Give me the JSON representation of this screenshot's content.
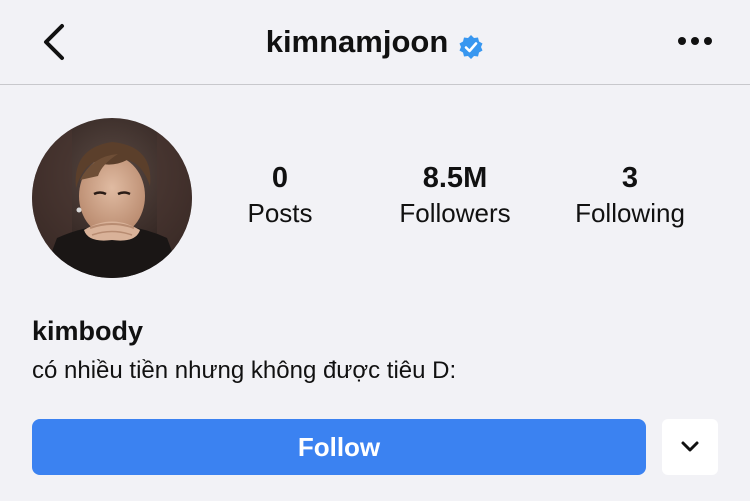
{
  "header": {
    "username": "kimnamjoon",
    "verified": true,
    "back_icon": "chevron-left-icon",
    "more_icon": "ellipsis-icon"
  },
  "profile": {
    "avatar": "profile-photo",
    "display_name": "kimbody",
    "bio": "có nhiều tiền nhưng không được tiêu D:"
  },
  "stats": {
    "posts": {
      "value": "0",
      "label": "Posts"
    },
    "followers": {
      "value": "8.5M",
      "label": "Followers"
    },
    "following": {
      "value": "3",
      "label": "Following"
    }
  },
  "actions": {
    "follow_label": "Follow",
    "dropdown_icon": "chevron-down-icon"
  },
  "colors": {
    "background": "#f2f2f6",
    "primary": "#3b82f1",
    "verified_badge": "#3897f0"
  }
}
